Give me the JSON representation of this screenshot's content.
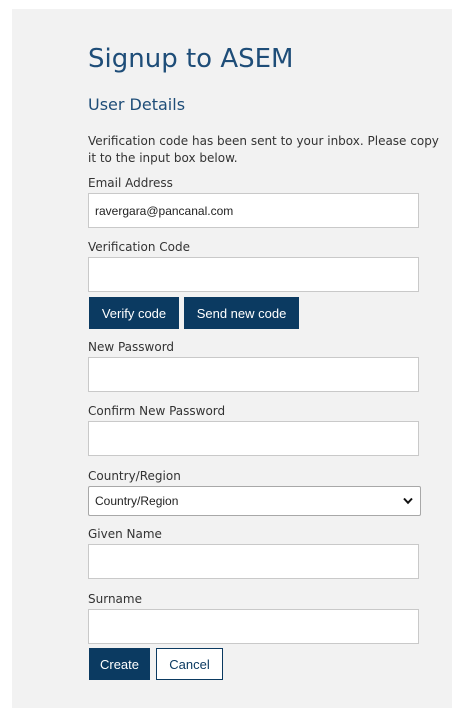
{
  "page": {
    "title": "Signup to ASEM",
    "subtitle": "User Details",
    "intro": "Verification code has been sent to your inbox. Please copy it to the input box below."
  },
  "form": {
    "email": {
      "label": "Email Address",
      "value": "ravergara@pancanal.com"
    },
    "verification_code": {
      "label": "Verification Code",
      "value": ""
    },
    "verify_button": "Verify code",
    "send_new_code_button": "Send new code",
    "new_password": {
      "label": "New Password",
      "value": ""
    },
    "confirm_password": {
      "label": "Confirm New Password",
      "value": ""
    },
    "country": {
      "label": "Country/Region",
      "selected": "Country/Region"
    },
    "given_name": {
      "label": "Given Name",
      "value": ""
    },
    "surname": {
      "label": "Surname",
      "value": ""
    },
    "create_button": "Create",
    "cancel_button": "Cancel"
  },
  "colors": {
    "heading": "#1e4d78",
    "primary_button": "#0b3a61",
    "panel_background": "#f2f2f2"
  },
  "icons": {
    "select_arrow": "chevron-down-icon"
  }
}
